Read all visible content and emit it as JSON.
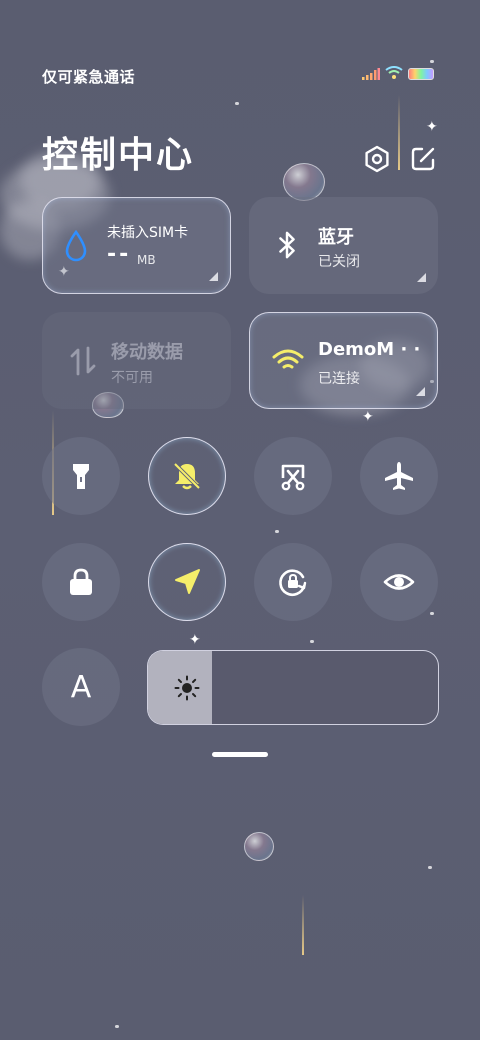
{
  "status_bar": {
    "carrier_text": "仅可紧急通话"
  },
  "header": {
    "title": "控制中心"
  },
  "cards": {
    "data_usage": {
      "title": "未插入SIM卡",
      "value": "--",
      "unit": "MB"
    },
    "bluetooth": {
      "title": "蓝牙",
      "status": "已关闭"
    },
    "mobile_data": {
      "title": "移动数据",
      "status": "不可用"
    },
    "wifi": {
      "title": "DemoM · ·",
      "status": "已连接"
    }
  },
  "toggles": {
    "font_label": "A"
  },
  "brightness": {
    "level": 0.22
  },
  "colors": {
    "background": "#5a5d70",
    "active_yellow": "#f5ee6a",
    "water_blue": "#2f8fff",
    "disabled_gray": "#9a9cab"
  },
  "icons": [
    "signal-icon",
    "wifi-icon",
    "battery-icon",
    "settings-icon",
    "edit-icon",
    "water-drop-icon",
    "bluetooth-icon",
    "data-arrows-icon",
    "wifi-icon",
    "flashlight-icon",
    "mute-bell-icon",
    "screenshot-icon",
    "airplane-icon",
    "lock-icon",
    "location-icon",
    "rotation-lock-icon",
    "eye-icon",
    "font-icon",
    "sun-icon"
  ]
}
